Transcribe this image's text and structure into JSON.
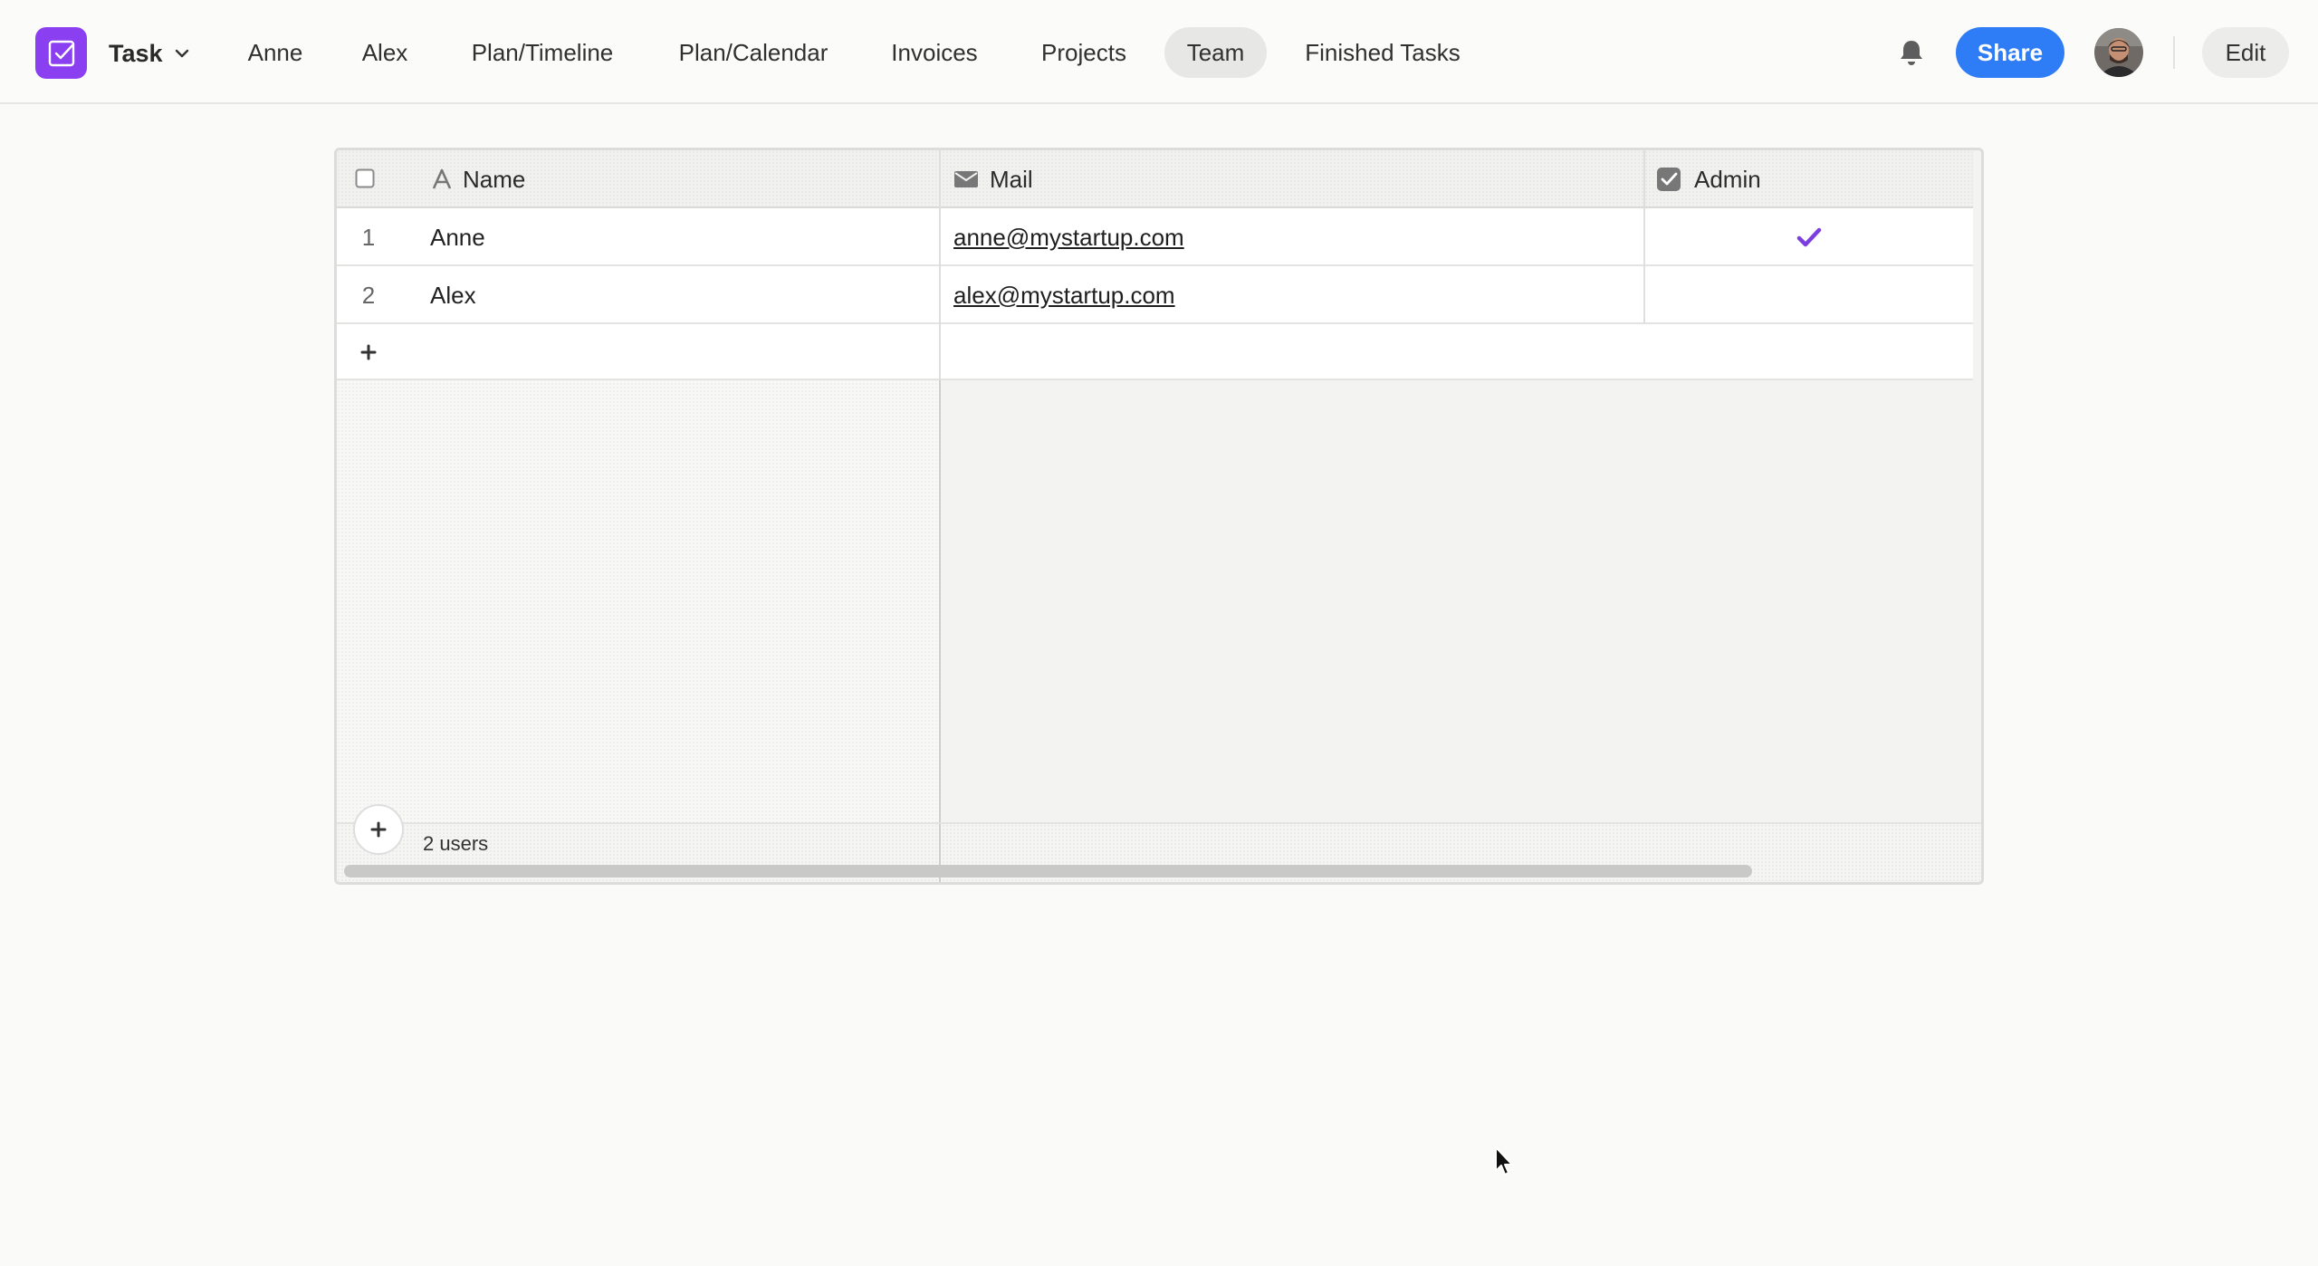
{
  "app": {
    "name": "Task",
    "logo_icon": "checkbox-icon",
    "accent": "#8a3ff0"
  },
  "nav": {
    "tabs": [
      {
        "label": "Anne"
      },
      {
        "label": "Alex"
      },
      {
        "label": "Plan/Timeline"
      },
      {
        "label": "Plan/Calendar"
      },
      {
        "label": "Invoices"
      },
      {
        "label": "Projects"
      },
      {
        "label": "Team",
        "active": true
      },
      {
        "label": "Finished Tasks"
      }
    ]
  },
  "header_actions": {
    "bell_icon": "bell-icon",
    "share_label": "Share",
    "share_color": "#2f7df6",
    "edit_label": "Edit"
  },
  "table": {
    "columns": [
      {
        "label": "Name",
        "icon": "text-type-icon"
      },
      {
        "label": "Mail",
        "icon": "mail-icon"
      },
      {
        "label": "Admin",
        "icon": "checkbox-icon"
      }
    ],
    "rows": [
      {
        "num": "1",
        "name": "Anne",
        "mail": "anne@mystartup.com",
        "admin": true
      },
      {
        "num": "2",
        "name": "Alex",
        "mail": "alex@mystartup.com",
        "admin": false
      }
    ],
    "add_row_icon": "plus-icon",
    "footer_count": "2 users",
    "check_color": "#7b3fe0"
  }
}
